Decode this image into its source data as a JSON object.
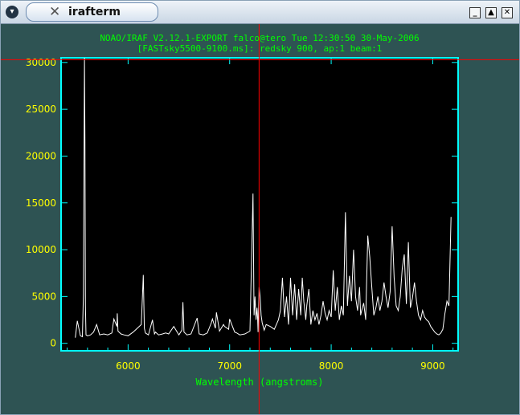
{
  "window": {
    "title": "irafterm",
    "menu_icon": "chevron-down-icon",
    "app_icon": "x-icon",
    "minimize_icon": "minimize-icon",
    "maximize_icon": "maximize-icon",
    "close_icon": "close-icon"
  },
  "colors": {
    "background": "#2e5353",
    "axes": "#00ffff",
    "text": "#00ff00",
    "ticks": "#ffff00",
    "spectrum": "#ffffff",
    "cursor": "#ff0000"
  },
  "chart_data": {
    "type": "line",
    "title": "NOAO/IRAF V2.12.1-EXPORT falco@tero Tue 12:30:50 30-May-2006",
    "subtitle": "[FASTsky5500-9100.ms]: redsky 900, ap:1 beam:1",
    "xlabel": "Wavelength (angstroms)",
    "ylabel": "",
    "xlim": [
      5340,
      9250
    ],
    "ylim": [
      -800,
      30500
    ],
    "xticks": [
      6000,
      7000,
      8000,
      9000
    ],
    "yticks": [
      0,
      5000,
      10000,
      15000,
      20000,
      25000,
      30000
    ],
    "cursor": {
      "x": 7290,
      "y": 30300
    },
    "series": [
      {
        "x": [
          5480,
          5500,
          5530,
          5550,
          5560,
          5570,
          5575,
          5580,
          5585,
          5600,
          5630,
          5660,
          5690,
          5720,
          5760,
          5800,
          5840,
          5860,
          5890,
          5893,
          5900,
          5930,
          5960,
          6000,
          6050,
          6090,
          6130,
          6150,
          6160,
          6170,
          6200,
          6240,
          6260,
          6270,
          6300,
          6340,
          6370,
          6400,
          6450,
          6500,
          6530,
          6540,
          6550,
          6580,
          6620,
          6680,
          6700,
          6740,
          6780,
          6820,
          6830,
          6860,
          6870,
          6900,
          6940,
          6950,
          6990,
          7000,
          7050,
          7070,
          7100,
          7150,
          7200,
          7230,
          7240,
          7250,
          7260,
          7270,
          7275,
          7280,
          7290,
          7300,
          7310,
          7320,
          7340,
          7360,
          7400,
          7440,
          7480,
          7500,
          7520,
          7540,
          7560,
          7580,
          7600,
          7620,
          7640,
          7660,
          7680,
          7700,
          7715,
          7730,
          7750,
          7760,
          7780,
          7800,
          7820,
          7840,
          7860,
          7880,
          7900,
          7920,
          7940,
          7960,
          7980,
          8000,
          8020,
          8040,
          8060,
          8080,
          8100,
          8120,
          8140,
          8160,
          8180,
          8200,
          8220,
          8240,
          8260,
          8280,
          8290,
          8300,
          8320,
          8340,
          8360,
          8380,
          8400,
          8420,
          8440,
          8460,
          8480,
          8500,
          8520,
          8540,
          8560,
          8580,
          8600,
          8620,
          8640,
          8660,
          8680,
          8700,
          8720,
          8740,
          8760,
          8780,
          8800,
          8820,
          8840,
          8860,
          8880,
          8900,
          8920,
          8940,
          8960,
          8980,
          9000,
          9020,
          9040,
          9060,
          9080,
          9100,
          9120,
          9140,
          9160,
          9180
        ],
        "y": [
          600,
          2400,
          800,
          700,
          5200,
          30500,
          21500,
          4000,
          900,
          800,
          900,
          1200,
          2000,
          900,
          1000,
          900,
          1100,
          2600,
          1800,
          3200,
          1300,
          1000,
          900,
          800,
          1200,
          1600,
          2000,
          7300,
          1600,
          1100,
          900,
          2500,
          1000,
          1200,
          900,
          1000,
          1100,
          1000,
          1800,
          900,
          1400,
          4400,
          1200,
          900,
          1000,
          2700,
          1000,
          900,
          1100,
          2200,
          2600,
          1600,
          3300,
          1300,
          2000,
          1800,
          1500,
          2600,
          1200,
          1100,
          900,
          1000,
          1300,
          16000,
          3000,
          5000,
          2500,
          3800,
          2800,
          1200,
          6000,
          5000,
          3000,
          2200,
          1400,
          2000,
          1800,
          1500,
          2500,
          3500,
          7000,
          2800,
          5000,
          2000,
          7000,
          3000,
          6300,
          2500,
          5800,
          3000,
          7000,
          4500,
          2500,
          4000,
          5800,
          2000,
          3500,
          2500,
          3200,
          2000,
          3000,
          4500,
          3200,
          2500,
          3500,
          2800,
          7800,
          3500,
          6000,
          2500,
          4000,
          3000,
          14000,
          4000,
          7200,
          4500,
          10000,
          5000,
          3500,
          6000,
          3000,
          3500,
          4300,
          2500,
          11500,
          9200,
          6000,
          3000,
          3800,
          5000,
          3500,
          4500,
          6500,
          5000,
          3800,
          5500,
          12500,
          7000,
          4000,
          3500,
          5000,
          8000,
          9500,
          4200,
          10800,
          3800,
          4800,
          6500,
          4500,
          3000,
          2500,
          3500,
          2800,
          2500,
          2300,
          1800,
          1500,
          1200,
          1000,
          900,
          1100,
          1500,
          3200,
          4500,
          4000,
          13500
        ]
      }
    ]
  }
}
